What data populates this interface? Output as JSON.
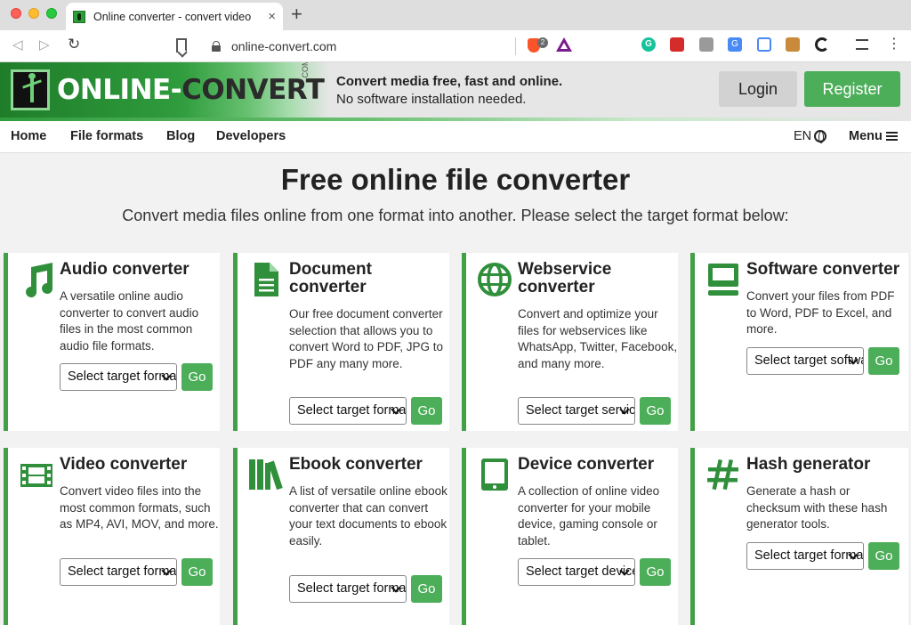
{
  "browser": {
    "tab_title": "Online converter - convert video",
    "tab_close": "×",
    "new_tab": "+",
    "url": "online-convert.com",
    "brave_badge": "2",
    "back": "◁",
    "forward": "▷",
    "reload": "↻",
    "menu": "⋮"
  },
  "site": {
    "logo_main": "ONLINE-",
    "logo_accent": "CONVERT",
    "logo_com": ".COM",
    "tagline_1": "Convert media free, fast and online.",
    "tagline_2": "No software installation needed.",
    "login": "Login",
    "register": "Register",
    "brand_color": "#4cae59"
  },
  "nav": {
    "items": [
      "Home",
      "File formats",
      "Blog",
      "Developers"
    ],
    "lang": "EN",
    "menu": "Menu"
  },
  "main": {
    "title": "Free online file converter",
    "subtitle": "Convert media files online from one format into another. Please select the target format below:"
  },
  "cards": [
    {
      "title": "Audio converter",
      "desc": "A versatile online audio converter to convert audio files in the most common audio file formats.",
      "select": "Select target format",
      "go": "Go",
      "icon": "music-note-icon"
    },
    {
      "title": "Document converter",
      "desc": "Our free document converter selection that allows you to convert Word to PDF, JPG to PDF any many more.",
      "select": "Select target format",
      "go": "Go",
      "icon": "document-icon"
    },
    {
      "title": "Webservice converter",
      "desc": "Convert and optimize your files for webservices like WhatsApp, Twitter, Facebook, and many more.",
      "select": "Select target service",
      "go": "Go",
      "icon": "globe-icon"
    },
    {
      "title": "Software converter",
      "desc": "Convert your files from PDF to Word, PDF to Excel, and more.",
      "select": "Select target software",
      "go": "Go",
      "icon": "monitor-icon"
    },
    {
      "title": "Video converter",
      "desc": "Convert video files into the most common formats, such as MP4, AVI, MOV, and more.",
      "select": "Select target format",
      "go": "Go",
      "icon": "film-icon"
    },
    {
      "title": "Ebook converter",
      "desc": "A list of versatile online ebook converter that can convert your text documents to ebook easily.",
      "select": "Select target format",
      "go": "Go",
      "icon": "books-icon"
    },
    {
      "title": "Device converter",
      "desc": "A collection of online video converter for your mobile device, gaming console or tablet.",
      "select": "Select target device",
      "go": "Go",
      "icon": "tablet-icon"
    },
    {
      "title": "Hash generator",
      "desc": "Generate a hash or checksum with these hash generator tools.",
      "select": "Select target format",
      "go": "Go",
      "icon": "hash-icon"
    }
  ]
}
